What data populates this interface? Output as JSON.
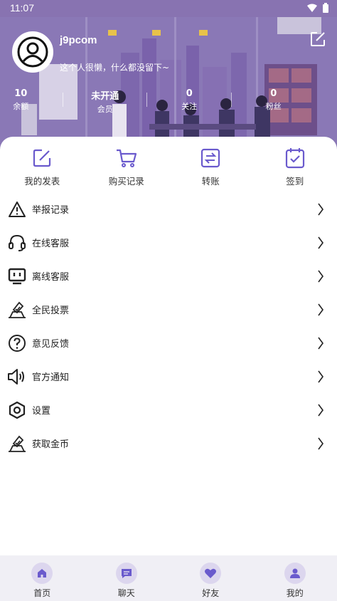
{
  "status_bar": {
    "time": "11:07"
  },
  "profile": {
    "username": "j9pcom",
    "signature": "这个人很懒，什么都没留下~"
  },
  "stats": [
    {
      "value": "10",
      "label": "余额"
    },
    {
      "value": "未开通",
      "label": "会员"
    },
    {
      "value": "0",
      "label": "关注"
    },
    {
      "value": "0",
      "label": "粉丝"
    }
  ],
  "quick_actions": [
    {
      "label": "我的发表",
      "icon": "edit-icon"
    },
    {
      "label": "购买记录",
      "icon": "cart-icon"
    },
    {
      "label": "转账",
      "icon": "transfer-icon"
    },
    {
      "label": "签到",
      "icon": "checkin-icon"
    }
  ],
  "menu": [
    {
      "label": "举报记录",
      "icon": "warning-icon"
    },
    {
      "label": "在线客服",
      "icon": "headset-icon"
    },
    {
      "label": "离线客服",
      "icon": "tv-icon"
    },
    {
      "label": "全民投票",
      "icon": "vote-icon"
    },
    {
      "label": "意见反馈",
      "icon": "question-icon"
    },
    {
      "label": "官方通知",
      "icon": "speaker-icon"
    },
    {
      "label": "设置",
      "icon": "settings-icon"
    },
    {
      "label": "获取金币",
      "icon": "coin-icon"
    }
  ],
  "tabs": [
    {
      "label": "首页",
      "icon": "home-icon"
    },
    {
      "label": "聊天",
      "icon": "chat-icon"
    },
    {
      "label": "好友",
      "icon": "heart-icon"
    },
    {
      "label": "我的",
      "icon": "user-icon"
    }
  ],
  "colors": {
    "accent": "#6a5acd",
    "header": "#8a78b6",
    "tab_icon_bg": "#dcd6ee"
  }
}
